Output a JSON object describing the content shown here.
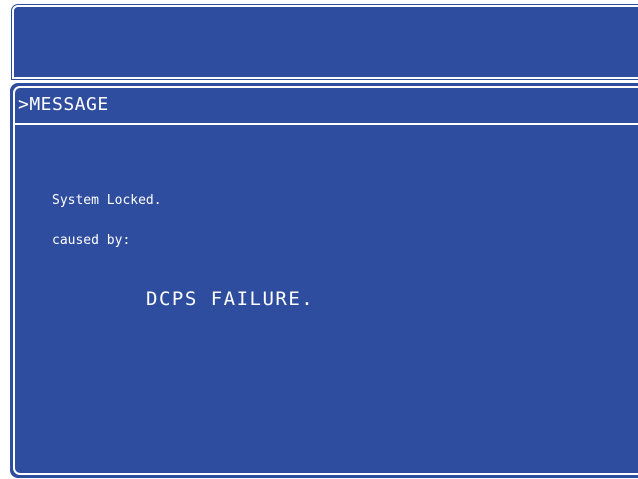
{
  "message_panel": {
    "header": ">MESSAGE",
    "status_text": "System Locked.",
    "cause_label": "caused by:",
    "failure_text": "DCPS FAILURE."
  },
  "colors": {
    "panel_background": "#2e4d9e",
    "text": "#ffffff",
    "border": "#ffffff"
  }
}
